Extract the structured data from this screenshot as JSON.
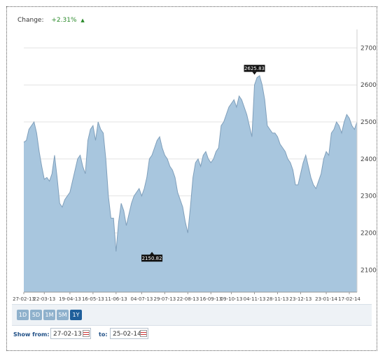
{
  "change": {
    "label": "Change:",
    "value": "+2.31%",
    "direction_icon": "up-triangle-icon"
  },
  "chart_data": {
    "type": "area",
    "title": "",
    "xlabel": "",
    "ylabel": "",
    "ylim": [
      2040,
      2750
    ],
    "yticks": [
      2100,
      2200,
      2300,
      2400,
      2500,
      2600,
      2700
    ],
    "xticks": [
      "27-02-13",
      "22-03-13",
      "19-04-13",
      "16-05-13",
      "11-06-13",
      "04-07-13",
      "29-07-13",
      "22-08-13",
      "16-09-13",
      "09-10-13",
      "04-11-13",
      "28-11-13",
      "23-12-13",
      "23-01-14",
      "17-02-14"
    ],
    "grid": true,
    "fill_color": "#a8c6de",
    "line_color": "#7f9fbb",
    "x": [
      "27-02-13",
      "01-03-13",
      "05-03-13",
      "07-03-13",
      "11-03-13",
      "14-03-13",
      "18-03-13",
      "20-03-13",
      "22-03-13",
      "26-03-13",
      "28-03-13",
      "02-04-13",
      "04-04-13",
      "08-04-13",
      "10-04-13",
      "12-04-13",
      "16-04-13",
      "18-04-13",
      "19-04-13",
      "23-04-13",
      "25-04-13",
      "29-04-13",
      "01-05-13",
      "03-05-13",
      "07-05-13",
      "09-05-13",
      "13-05-13",
      "16-05-13",
      "20-05-13",
      "22-05-13",
      "24-05-13",
      "28-05-13",
      "30-05-13",
      "03-06-13",
      "05-06-13",
      "07-06-13",
      "11-06-13",
      "13-06-13",
      "17-06-13",
      "19-06-13",
      "21-06-13",
      "24-06-13",
      "26-06-13",
      "28-06-13",
      "01-07-13",
      "02-07-13",
      "04-07-13",
      "08-07-13",
      "10-07-13",
      "12-07-13",
      "16-07-13",
      "18-07-13",
      "22-07-13",
      "24-07-13",
      "26-07-13",
      "29-07-13",
      "31-07-13",
      "02-08-13",
      "06-08-13",
      "08-08-13",
      "12-08-13",
      "14-08-13",
      "16-08-13",
      "20-08-13",
      "22-08-13",
      "26-08-13",
      "28-08-13",
      "30-08-13",
      "03-09-13",
      "05-09-13",
      "09-09-13",
      "11-09-13",
      "13-09-13",
      "16-09-13",
      "18-09-13",
      "20-09-13",
      "24-09-13",
      "26-09-13",
      "30-09-13",
      "02-10-13",
      "04-10-13",
      "09-10-13",
      "11-10-13",
      "15-10-13",
      "17-10-13",
      "21-10-13",
      "23-10-13",
      "25-10-13",
      "29-10-13",
      "31-10-13",
      "04-11-13",
      "06-11-13",
      "08-11-13",
      "12-11-13",
      "14-11-13",
      "18-11-13",
      "20-11-13",
      "22-11-13",
      "26-11-13",
      "28-11-13",
      "02-12-13",
      "04-12-13",
      "06-12-13",
      "10-12-13",
      "12-12-13",
      "16-12-13",
      "18-12-13",
      "20-12-13",
      "23-12-13",
      "27-12-13",
      "31-12-13",
      "03-01-14",
      "07-01-14",
      "09-01-14",
      "13-01-14",
      "15-01-14",
      "17-01-14",
      "21-01-14",
      "23-01-14",
      "27-01-14",
      "29-01-14",
      "31-01-14",
      "04-02-14",
      "06-02-14",
      "10-02-14",
      "12-02-14",
      "14-02-14",
      "17-02-14",
      "19-02-14",
      "21-02-14",
      "25-02-14"
    ],
    "series": [
      {
        "values": [
          2445,
          2450,
          2480,
          2490,
          2500,
          2470,
          2420,
          2380,
          2345,
          2350,
          2340,
          2360,
          2410,
          2350,
          2280,
          2270,
          2290,
          2300,
          2310,
          2340,
          2370,
          2400,
          2410,
          2380,
          2360,
          2450,
          2480,
          2490,
          2450,
          2500,
          2480,
          2470,
          2400,
          2300,
          2240,
          2240,
          2150,
          2230,
          2280,
          2260,
          2220,
          2250,
          2280,
          2300,
          2310,
          2320,
          2300,
          2320,
          2350,
          2400,
          2410,
          2430,
          2450,
          2460,
          2430,
          2410,
          2400,
          2380,
          2370,
          2350,
          2310,
          2290,
          2270,
          2230,
          2200,
          2270,
          2350,
          2390,
          2400,
          2380,
          2410,
          2420,
          2400,
          2390,
          2400,
          2420,
          2430,
          2490,
          2500,
          2520,
          2540,
          2550,
          2560,
          2540,
          2570,
          2560,
          2540,
          2520,
          2490,
          2460,
          2600,
          2620,
          2625,
          2600,
          2560,
          2490,
          2480,
          2470,
          2470,
          2460,
          2440,
          2430,
          2420,
          2400,
          2390,
          2370,
          2330,
          2330,
          2360,
          2390,
          2410,
          2380,
          2350,
          2330,
          2320,
          2340,
          2360,
          2400,
          2420,
          2410,
          2470,
          2480,
          2500,
          2490,
          2470,
          2500,
          2520,
          2510,
          2490,
          2480,
          2500
        ]
      }
    ],
    "annotations": [
      {
        "x": "16-07-13",
        "y": 2150.82,
        "label": "2150.82"
      },
      {
        "x": "04-11-13",
        "y": 2625.83,
        "label": "2625.83"
      }
    ]
  },
  "range_buttons": [
    {
      "label": "1D",
      "active": false
    },
    {
      "label": "5D",
      "active": false
    },
    {
      "label": "1M",
      "active": false
    },
    {
      "label": "5M",
      "active": false
    },
    {
      "label": "1Y",
      "active": true
    }
  ],
  "date_range": {
    "from_label": "Show from:",
    "from_value": "27-02-13",
    "to_label": "to:",
    "to_value": "25-02-14",
    "calendar_icon": "calendar-icon"
  }
}
